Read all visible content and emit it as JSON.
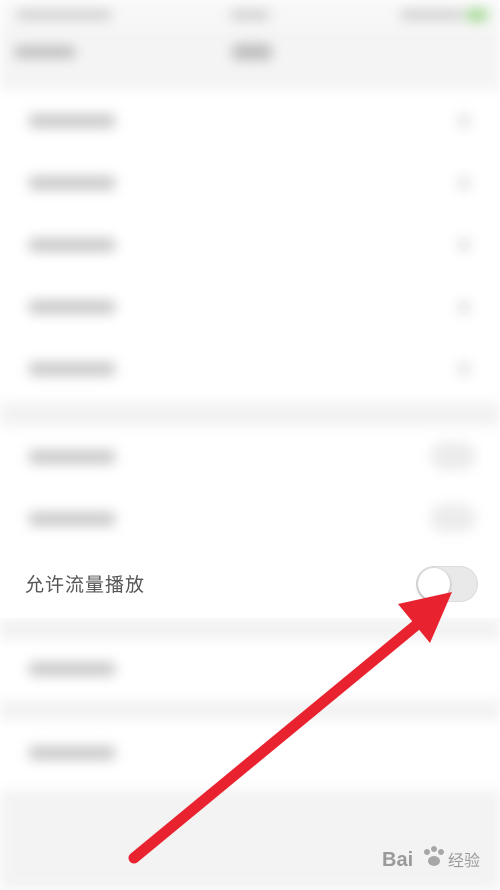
{
  "settings": {
    "allow_cellular_playback_label": "允许流量播放",
    "allow_cellular_playback_state": "off"
  },
  "annotation": {
    "arrow_color": "#e8232f"
  },
  "watermark": {
    "brand": "Bai",
    "brand_suffix": "经验"
  }
}
